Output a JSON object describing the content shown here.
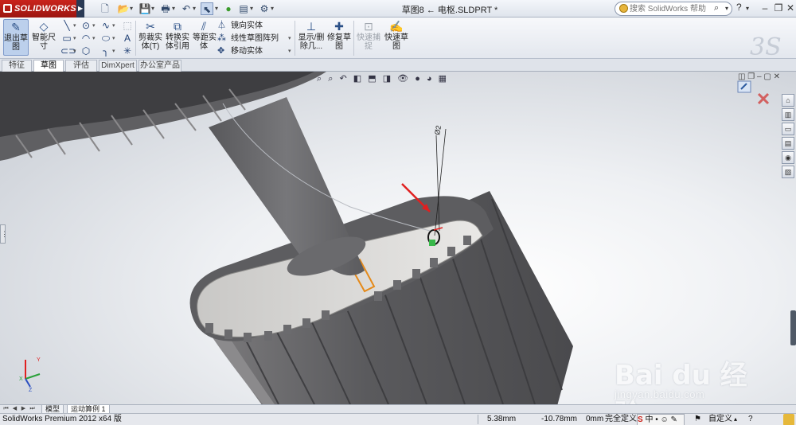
{
  "app": {
    "brand": "SOLIDWORKS",
    "document_title": "草图8 ← 电枢.SLDPRT *"
  },
  "quick_access": [
    {
      "name": "new",
      "icon": "new-document-icon",
      "glyph": "🗋"
    },
    {
      "name": "open",
      "icon": "open-folder-icon",
      "glyph": "📂"
    },
    {
      "name": "save",
      "icon": "save-icon",
      "glyph": "💾"
    },
    {
      "name": "print",
      "icon": "print-icon",
      "glyph": "🖶"
    },
    {
      "name": "undo",
      "icon": "undo-icon",
      "glyph": "↶"
    },
    {
      "name": "select",
      "icon": "select-arrow-icon",
      "glyph": "⬉"
    },
    {
      "name": "rebuild",
      "icon": "rebuild-icon",
      "glyph": "🚦"
    },
    {
      "name": "file-properties",
      "icon": "file-properties-icon",
      "glyph": "▤"
    },
    {
      "name": "options",
      "icon": "options-icon",
      "glyph": "⚙"
    }
  ],
  "help_search": {
    "placeholder": "搜索 SolidWorks 帮助"
  },
  "command_manager": {
    "exit_sketch": "退出草\n图",
    "smart_dimension": "智能尺\n寸",
    "trim_entities": "剪裁实\n体(T)",
    "convert_entities": "转换实\n体引用",
    "offset_entities": "等距实\n体",
    "mirror_entities": "镜向实体",
    "linear_pattern": "线性草图阵列",
    "move_entities": "移动实体",
    "display_delete_relations": "显示/删\n除几...",
    "repair_sketch": "修复草\n图",
    "quick_snaps": "快速捕\n捉",
    "rapid_sketch": "快速草\n图"
  },
  "tabs": [
    "特征",
    "草图",
    "评估",
    "DimXpert",
    "办公室产品"
  ],
  "active_tab": "草图",
  "viewport": {
    "dimension_label": "Ø2",
    "watermark_brand": "Bai du 经验",
    "watermark_url": "jingyan.baidu.com"
  },
  "model_tabs": [
    "模型",
    "运动算例 1"
  ],
  "status": {
    "product": "SolidWorks Premium 2012 x64 版",
    "x": "5.38mm",
    "y": "-10.78mm",
    "z": "0mm",
    "state": "完全定义",
    "units": "自定义"
  },
  "colors": {
    "brand_red": "#c9231c",
    "selection_red": "#e02020",
    "highlight_orange": "#e58a1a",
    "part_gray": "#6f6f72"
  }
}
